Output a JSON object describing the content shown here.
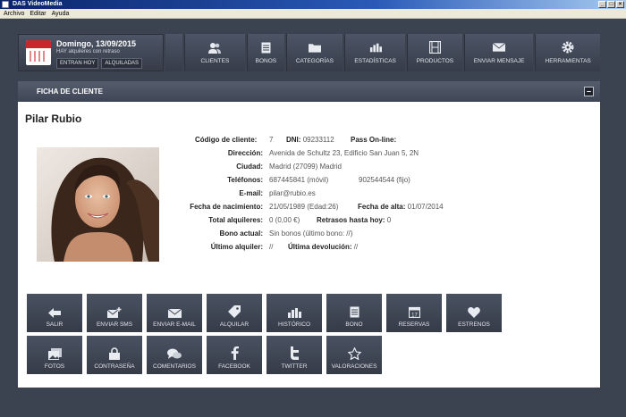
{
  "window": {
    "title": "DAS VideoMedia"
  },
  "menu": [
    "Archivo",
    "Editar",
    "Ayuda"
  ],
  "header": {
    "date": "Domingo, 13/09/2015",
    "notice": "HAY alquileres con retraso",
    "buttons": [
      "ENTRAN HOY",
      "ALQUILADAS"
    ]
  },
  "nav": [
    {
      "label": "CLIENTES",
      "icon": "users-icon"
    },
    {
      "label": "BONOS",
      "icon": "document-icon"
    },
    {
      "label": "CATEGORÍAS",
      "icon": "folder-icon"
    },
    {
      "label": "ESTADÍSTICAS",
      "icon": "bar-chart-icon"
    },
    {
      "label": "PRODUCTOS",
      "icon": "film-icon"
    },
    {
      "label": "ENVIAR MENSAJE",
      "icon": "envelope-icon"
    },
    {
      "label": "HERRAMIENTAS",
      "icon": "gear-icon"
    }
  ],
  "panel": {
    "title": "FICHA DE CLIENTE"
  },
  "client": {
    "name": "Pilar Rubio",
    "code_label": "Código de cliente:",
    "code": "7",
    "dni_label": "DNI:",
    "dni": "09233112",
    "pass_label": "Pass On-line:",
    "address_label": "Dirección:",
    "address": "Avenida de Schultz 23, Edificio San Juan 5, 2N",
    "city_label": "Ciudad:",
    "city": "Madrid (27099) Madrid",
    "phones_label": "Teléfonos:",
    "phone_mobile": "687445841 (móvil)",
    "phone_fixed": "902544544 (fijo)",
    "email_label": "E-mail:",
    "email": "pilar@rubio.es",
    "birth_label": "Fecha de nacimiento:",
    "birth": "21/05/1989 (Edad:26)",
    "signup_label": "Fecha de alta:",
    "signup": "01/07/2014",
    "rentals_label": "Total alquileres:",
    "rentals": "0 (0,00 €)",
    "late_label": "Retrasos hasta hoy:",
    "late": "0",
    "bonus_label": "Bono actual:",
    "bonus": "Sin bonos (último bono: //)",
    "last_rental_label": "Último alquiler:",
    "last_rental": "//",
    "last_return_label": "Última devolución:",
    "last_return": "//"
  },
  "actions": [
    {
      "label": "SALIR",
      "icon": "arrow-left-icon"
    },
    {
      "label": "ENVIAR SMS",
      "icon": "sms-icon"
    },
    {
      "label": "ENVIAR E-MAIL",
      "icon": "envelope-icon"
    },
    {
      "label": "ALQUILAR",
      "icon": "tag-icon"
    },
    {
      "label": "HISTÓRICO",
      "icon": "bar-chart-icon"
    },
    {
      "label": "BONO",
      "icon": "document-icon"
    },
    {
      "label": "RESERVAS",
      "icon": "calendar-icon"
    },
    {
      "label": "ESTRENOS",
      "icon": "heart-icon"
    },
    {
      "label": "FOTOS",
      "icon": "photos-icon"
    },
    {
      "label": "CONTRASEÑA",
      "icon": "lock-icon"
    },
    {
      "label": "COMENTARIOS",
      "icon": "comments-icon"
    },
    {
      "label": "FACEBOOK",
      "icon": "facebook-icon"
    },
    {
      "label": "TWITTER",
      "icon": "twitter-icon"
    },
    {
      "label": "VALORACIONES",
      "icon": "star-icon"
    }
  ]
}
